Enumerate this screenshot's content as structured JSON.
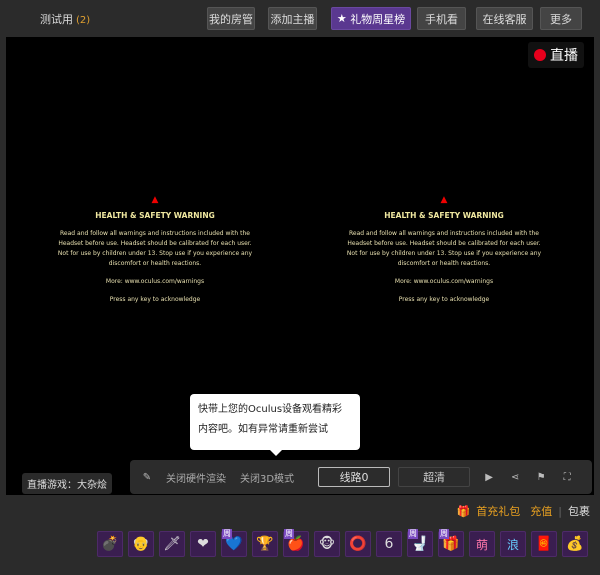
{
  "header": {
    "room_title": "测试用",
    "count": "(2)",
    "buttons": [
      "我的房管",
      "添加主播",
      "礼物周星榜",
      "手机看",
      "在线客服",
      "更多"
    ]
  },
  "video": {
    "live_label": "直播",
    "warning": {
      "title": "HEALTH & SAFETY WARNING",
      "body": "Read and follow all warnings and instructions included with the Headset before use. Headset should be calibrated for each user. Not for use by children under 13. Stop use if you experience any discomfort or health reactions.",
      "more": "More: www.oculus.com/warnings",
      "press": "Press any key to acknowledge"
    },
    "tooltip": "快带上您的Oculus设备观看精彩内容吧。如有异常请重新尝试",
    "game_label": "直播游戏：大杂烩",
    "controls": {
      "hw_render": "关闭硬件渲染",
      "mode_3d": "关闭3D模式",
      "line": "线路0",
      "quality": "超清"
    }
  },
  "gift_bar": {
    "first_charge": "首充礼包",
    "recharge": "充值",
    "bag": "包裹",
    "week_badge": "周",
    "gifts": [
      "bomb",
      "person",
      "sword",
      "heart",
      "blue-heart",
      "trophy",
      "apple",
      "monkey",
      "badge",
      "666",
      "toilet",
      "gift-box",
      "萌",
      "浪",
      "red-envelope",
      "treasure"
    ],
    "accent": "#e8a020"
  }
}
